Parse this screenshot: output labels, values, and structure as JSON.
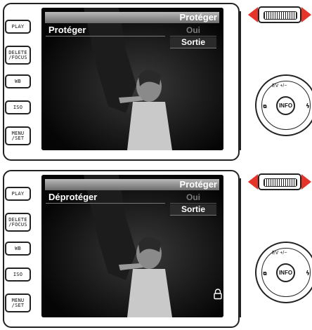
{
  "side_buttons": [
    "PLAY",
    "DELETE\n/FOCUS",
    "WB",
    "ISO",
    "MENU\n/SET"
  ],
  "dpad": {
    "ev": "EV +/−",
    "center": "INFO",
    "left": "ᴓ",
    "right": "ϟ"
  },
  "panels": [
    {
      "header": "Protéger",
      "menu_item": "Protéger",
      "option_dim": "Oui",
      "option_selected": "Sortie",
      "lock_shown": false
    },
    {
      "header": "Protéger",
      "menu_item": "Déprotéger",
      "option_dim": "Oui",
      "option_selected": "Sortie",
      "lock_shown": true
    }
  ],
  "colors": {
    "arrow": "#e5342a",
    "screen": "#0a0a0a",
    "titlebar_top": "#b9b9b9",
    "titlebar_bottom": "#6d6d6d"
  }
}
